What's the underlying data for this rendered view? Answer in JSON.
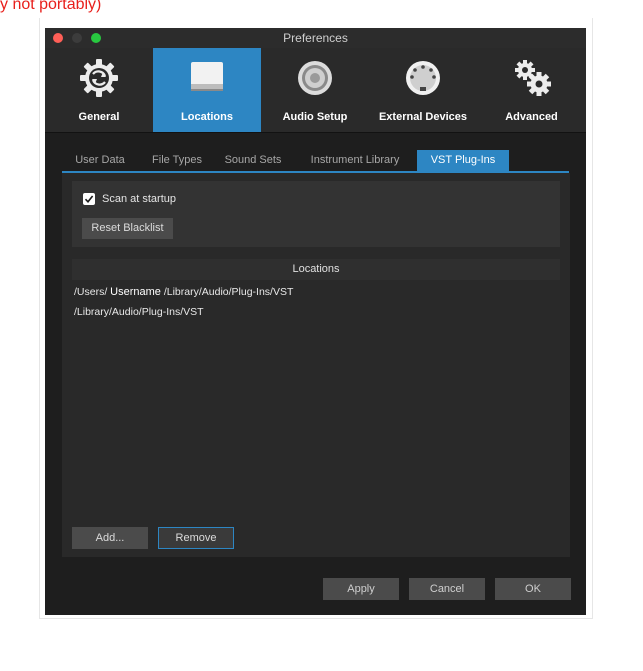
{
  "caption": "y not portably)",
  "window": {
    "title": "Preferences"
  },
  "toolbar": {
    "items": [
      {
        "label": "General",
        "icon": "gear-sync-icon"
      },
      {
        "label": "Locations",
        "icon": "folder-icon"
      },
      {
        "label": "Audio Setup",
        "icon": "speaker-icon"
      },
      {
        "label": "External Devices",
        "icon": "midi-port-icon"
      },
      {
        "label": "Advanced",
        "icon": "gears-icon"
      }
    ],
    "active": "Locations"
  },
  "tabs": {
    "items": [
      "User Data",
      "File Types",
      "Sound Sets",
      "Instrument Library",
      "VST Plug-Ins"
    ],
    "active": "VST Plug-Ins"
  },
  "vst": {
    "scan_at_startup": {
      "label": "Scan at startup",
      "checked": true
    },
    "reset_blacklist_label": "Reset Blacklist",
    "locations_header": "Locations",
    "locations": [
      {
        "prefix": "/Users/ ",
        "user": "Username",
        "suffix": " /Library/Audio/Plug-Ins/VST"
      },
      {
        "prefix": "/Library/Audio/Plug-Ins/VST",
        "user": "",
        "suffix": ""
      }
    ],
    "add_label": "Add...",
    "remove_label": "Remove"
  },
  "footer": {
    "apply_label": "Apply",
    "cancel_label": "Cancel",
    "ok_label": "OK"
  },
  "colors": {
    "accent": "#2d86c3",
    "background": "#1e1e1e",
    "caption_red": "#e8201c"
  }
}
